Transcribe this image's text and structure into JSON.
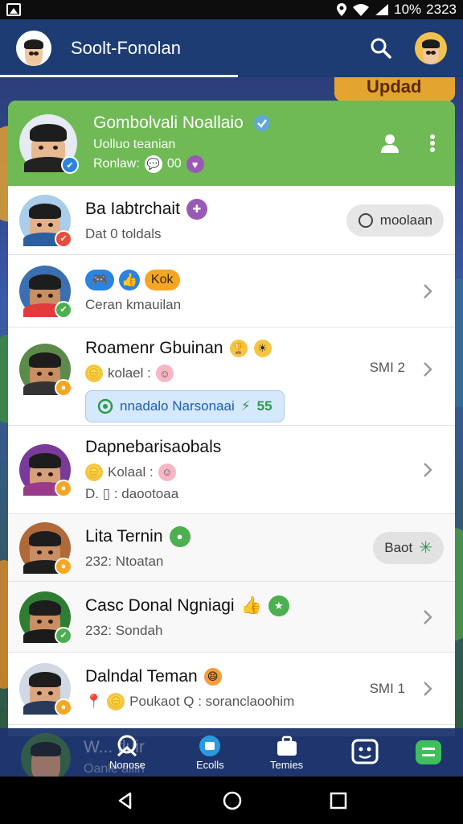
{
  "status_bar": {
    "battery": "10%",
    "time": "2323"
  },
  "header": {
    "title": "Soolt-Fonolan"
  },
  "background": {
    "banner": "Updad"
  },
  "featured": {
    "name": "Gombolvali Noallaio",
    "line1": "Uolluo teanian",
    "line2": "Ronlaw:",
    "count": "00"
  },
  "rows": [
    {
      "name": "Ba Iabtrchait",
      "sub": "Dat 0 toldals",
      "action": "moolaan"
    },
    {
      "tag1": "Kok",
      "sub": "Ceran kmauilan"
    },
    {
      "name": "Roamenr Gbuinan",
      "sub": "kolael :",
      "meta": "SMI 2",
      "chip": "nnadalo Narsonaai",
      "chip_count": "55"
    },
    {
      "name": "Dapnebarisaobals",
      "sub": "Kolaal :",
      "sub2": "D. ▯ : daootoaa"
    },
    {
      "name": "Lita Ternin",
      "sub": "232: Ntoatan",
      "action": "Baot"
    },
    {
      "name": "Casc Donal Ngniagi",
      "sub": "232: Sondah"
    },
    {
      "name": "Dalndal Teman",
      "sub": "Poukaot Q : soranclaoohim",
      "meta": "SMI 1"
    }
  ],
  "bottom_nav": {
    "peek_name": "W... fluir",
    "peek_sub": "Oanle aliin",
    "items": [
      "Nonose",
      "Ecolls",
      "Temies"
    ]
  },
  "colors": {
    "header": "#1e3c74",
    "featured": "#6fba55",
    "accent_blue": "#2a84e0",
    "online_green": "#4caf50",
    "away_orange": "#f5a623",
    "alert_red": "#e74c3c"
  }
}
